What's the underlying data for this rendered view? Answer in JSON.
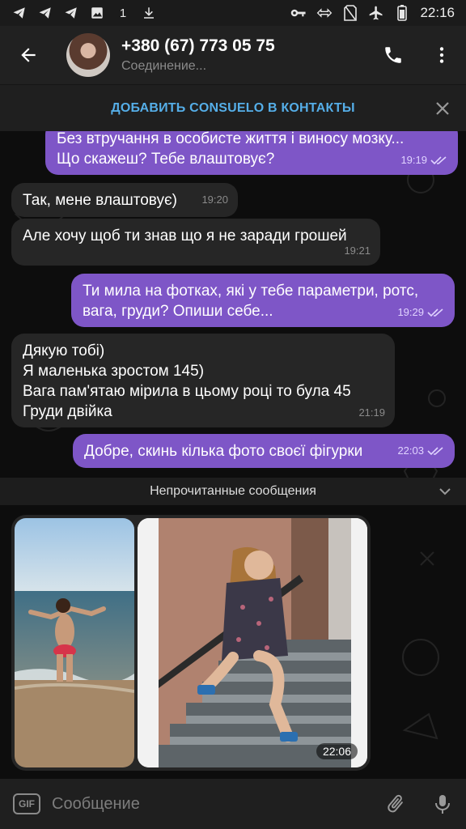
{
  "status_bar": {
    "time": "22:16",
    "left_icons": [
      "telegram-icon",
      "telegram-icon",
      "telegram-icon",
      "image-icon",
      "arrow-up-icon",
      "download-icon"
    ],
    "right_icons": [
      "key-icon",
      "sync-icon",
      "no-sim-icon",
      "airplane-icon",
      "battery-icon"
    ],
    "network_indicator": "1"
  },
  "header": {
    "title": "+380 (67) 773 05 75",
    "subtitle": "Соединение..."
  },
  "add_contact": {
    "label": "ДОБАВИТЬ CONSUELO В КОНТАКТЫ"
  },
  "messages": [
    {
      "direction": "out",
      "lines": [
        "Без втручання в особисте життя і виносу мозку...",
        "Що скажеш? Тебе влаштовує?"
      ],
      "time": "19:19",
      "read": true
    },
    {
      "direction": "in",
      "lines": [
        "Так, мене влаштовує)"
      ],
      "time": "19:20"
    },
    {
      "direction": "in",
      "lines": [
        "Але хочу щоб ти знав що я не заради грошей"
      ],
      "time": "19:21"
    },
    {
      "direction": "out",
      "lines": [
        "Ти мила на фотках, які у тебе параметри, ротс,",
        "вага, груди? Опиши себе..."
      ],
      "time": "19:29",
      "read": true
    },
    {
      "direction": "in",
      "lines": [
        "Дякую тобі)",
        "Я маленька зростом 145)",
        "Вага пам'ятаю мірила в цьому році то була 45",
        "Груди  двійка"
      ],
      "time": "21:19"
    },
    {
      "direction": "out",
      "lines": [
        "Добре, скинь кілька фото своєї фігурки"
      ],
      "time": "22:03",
      "read": true
    }
  ],
  "unread_divider": {
    "label": "Непрочитанные сообщения"
  },
  "photo_message": {
    "time": "22:06",
    "photos": [
      "beach-photo",
      "stairs-photo"
    ]
  },
  "input_bar": {
    "placeholder": "Сообщение",
    "gif_label": "GIF"
  },
  "colors": {
    "outgoing_bubble": "#7e56c7",
    "incoming_bubble": "#262626",
    "accent_link": "#55aee8",
    "background": "#0d0d0d"
  }
}
